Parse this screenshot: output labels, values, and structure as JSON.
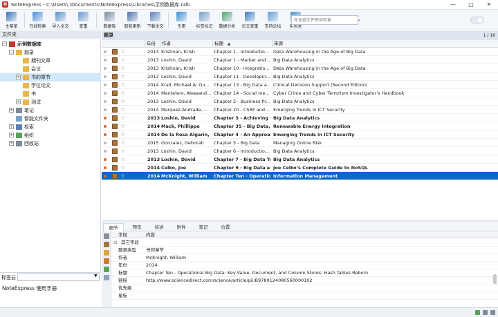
{
  "window": {
    "app_icon_letter": "N",
    "title": "NoteExpress - C:\\Users\\        \\Documents\\NoteExpress\\Libraries\\示例数据库.ndb",
    "controls": [
      "—",
      "□",
      "✕"
    ]
  },
  "toolbar": {
    "buttons": [
      {
        "label": "主菜单",
        "icon": "menu-icon",
        "color": "#3a6fb5"
      },
      {
        "label": "在线检索",
        "icon": "globe-search-icon",
        "color": "#4b8fd6"
      },
      {
        "label": "导入全文",
        "icon": "import-fulltext-icon",
        "color": "#5a8fc4"
      },
      {
        "label": "查重",
        "icon": "duplicate-search-icon",
        "color": "#6a9bd0"
      },
      {
        "label": "数据库",
        "icon": "database-icon",
        "color": "#7d8a99"
      },
      {
        "label": "智能更新",
        "icon": "smart-update-icon",
        "color": "#4b6ea8"
      },
      {
        "label": "下载全文",
        "icon": "download-icon",
        "color": "#5b7fb8"
      },
      {
        "label": "引用",
        "icon": "cite-icon",
        "color": "#3a8fd6"
      },
      {
        "label": "标签标记",
        "icon": "tag-icon",
        "color": "#7a9cc4"
      },
      {
        "label": "数据分析",
        "icon": "analysis-icon",
        "color": "#4fa46a"
      },
      {
        "label": "论文查重",
        "icon": "paper-check-icon",
        "color": "#3b7ec4"
      },
      {
        "label": "支持论坛",
        "icon": "forum-icon",
        "color": "#5aa0d8"
      },
      {
        "label": "实验室",
        "icon": "lab-icon",
        "color": "#4c8fd0"
      }
    ]
  },
  "search": {
    "placeholder": "在全部文件夹中检索",
    "dropdown_icon": "chevron-down-icon"
  },
  "left_panel": {
    "header": "文件夹",
    "tree": [
      {
        "label": "示例数据库",
        "level": 0,
        "exp": "−",
        "icon": "database",
        "bold": true
      },
      {
        "label": "题录",
        "level": 1,
        "exp": "−",
        "icon": "folder"
      },
      {
        "label": "期刊文章",
        "level": 2,
        "exp": "",
        "icon": "folder"
      },
      {
        "label": "会议",
        "level": 2,
        "exp": "",
        "icon": "folder"
      },
      {
        "label": "书的章节",
        "level": 2,
        "exp": "+",
        "icon": "folder",
        "selected": true
      },
      {
        "label": "学位论文",
        "level": 2,
        "exp": "",
        "icon": "folder"
      },
      {
        "label": "书",
        "level": 2,
        "exp": "",
        "icon": "folder"
      },
      {
        "label": "测试",
        "level": 2,
        "exp": "+",
        "icon": "folder"
      },
      {
        "label": "笔记",
        "level": 1,
        "exp": "+",
        "icon": "note"
      },
      {
        "label": "智能文件夹",
        "level": 1,
        "exp": "",
        "icon": "smartfolder"
      },
      {
        "label": "检索",
        "level": 1,
        "exp": "+",
        "icon": "search"
      },
      {
        "label": "组织",
        "level": 1,
        "exp": "+",
        "icon": "org"
      },
      {
        "label": "回收站",
        "level": 1,
        "exp": "+",
        "icon": "trash"
      }
    ],
    "tag_cloud_label": "标签云",
    "tag_item": "NoteExpress  使用手册"
  },
  "list_panel": {
    "header": "题录",
    "count": "1 / 16",
    "columns": [
      "年份",
      "作者",
      "标题",
      "来源"
    ],
    "sort_indicator": "▲",
    "rows": [
      {
        "year": "2013",
        "author": "Krishnan, Krish",
        "title": "Chapter 1 - Introductio...",
        "source": "Data Warehousing in the Age of Big Data",
        "unread": false,
        "bold": false
      },
      {
        "year": "2013",
        "author": "Loshin, David",
        "title": "Chapter 1 - Market and ...",
        "source": "Big Data Analytics",
        "unread": false,
        "bold": false
      },
      {
        "year": "2013",
        "author": "Krishnan, Krish",
        "title": "Chapter 10 - Integratio...",
        "source": "Data Warehousing in the Age of Big Data",
        "unread": false,
        "bold": false
      },
      {
        "year": "2013",
        "author": "Loshin, David",
        "title": "Chapter 11 - Developin...",
        "source": "Big Data Analytics",
        "unread": false,
        "bold": false
      },
      {
        "year": "2014",
        "author": "Krall, Michael A; Gu...",
        "title": "Chapter 13 - Big Data a...",
        "source": "Clinical Decision Support (Second Edition)",
        "unread": false,
        "bold": false
      },
      {
        "year": "2014",
        "author": "Mantelero, Alessand...",
        "title": "Chapter 14 - Social me...",
        "source": "Cyber Crime and Cyber Terrorism Investigator's Handbook",
        "unread": false,
        "bold": false
      },
      {
        "year": "2013",
        "author": "Loshin, David",
        "title": "Chapter 2 - Business Pr...",
        "source": "Big Data Analytics",
        "unread": false,
        "bold": false
      },
      {
        "year": "2014",
        "author": "Marquez-Andrade, ...",
        "title": "Chapter 20 - CSRF and ...",
        "source": "Emerging Trends in ICT Security",
        "unread": false,
        "bold": false
      },
      {
        "year": "2013",
        "author": "Loshin, David",
        "title": "Chapter 3 - Achieving O...",
        "source": "Big Data Analytics",
        "unread": true,
        "bold": true
      },
      {
        "year": "2014",
        "author": "Mack, Phillippe",
        "title": "Chapter 35 - Big Data, ...",
        "source": "Renewable Energy Integration",
        "unread": true,
        "bold": true
      },
      {
        "year": "2014",
        "author": "De la Rosa Algarin, ...",
        "title": "Chapter 4 - An Approac...",
        "source": "Emerging Trends in ICT Security",
        "unread": true,
        "bold": true
      },
      {
        "year": "2015",
        "author": "Gonzalez, Deborah",
        "title": "Chapter 5 - Big Data",
        "source": "Managing Online Risk",
        "unread": false,
        "bold": false
      },
      {
        "year": "2013",
        "author": "Loshin, David",
        "title": "Chapter 6 - Introductio...",
        "source": "Big Data Analytics",
        "unread": false,
        "bold": false
      },
      {
        "year": "2013",
        "author": "Loshin, David",
        "title": "Chapter 7 - Big Data To...",
        "source": "Big Data Analytics",
        "unread": true,
        "bold": true
      },
      {
        "year": "2014",
        "author": "Celko, Joe",
        "title": "Chapter 9 - Big Data an...",
        "source": "Joe Celko’s Complete Guide to NoSQL",
        "unread": true,
        "bold": true
      },
      {
        "year": "2014",
        "author": "McKnight, William",
        "title": "Chapter Ten - Operatio...",
        "source": "Information Management",
        "unread": true,
        "bold": true,
        "selected": true
      }
    ]
  },
  "detail": {
    "tabs": [
      "细节",
      "预览",
      "综述",
      "附件",
      "笔记",
      "位置"
    ],
    "active_tab": 0,
    "header": [
      "字段",
      "内容"
    ],
    "group": "其它字段",
    "fields": [
      {
        "key": "题录类型",
        "value": "书的章节"
      },
      {
        "key": "作者",
        "value": "McKnight, William"
      },
      {
        "key": "年份",
        "value": "2014"
      },
      {
        "key": "标题",
        "value": "Chapter Ten - Operational Big Data: Key-Value, Document, and Column Stores: Hash Tables Reborn"
      },
      {
        "key": "链接",
        "value": "http://www.sciencedirect.com/science/article/pii/B9780124080560000102"
      },
      {
        "key": "优先级",
        "value": ""
      },
      {
        "key": "星标",
        "value": ""
      }
    ]
  },
  "colors": {
    "accent": "#0a68c8",
    "tree_selected": "#cfe8fb",
    "unread_dot": "#d4672d"
  }
}
